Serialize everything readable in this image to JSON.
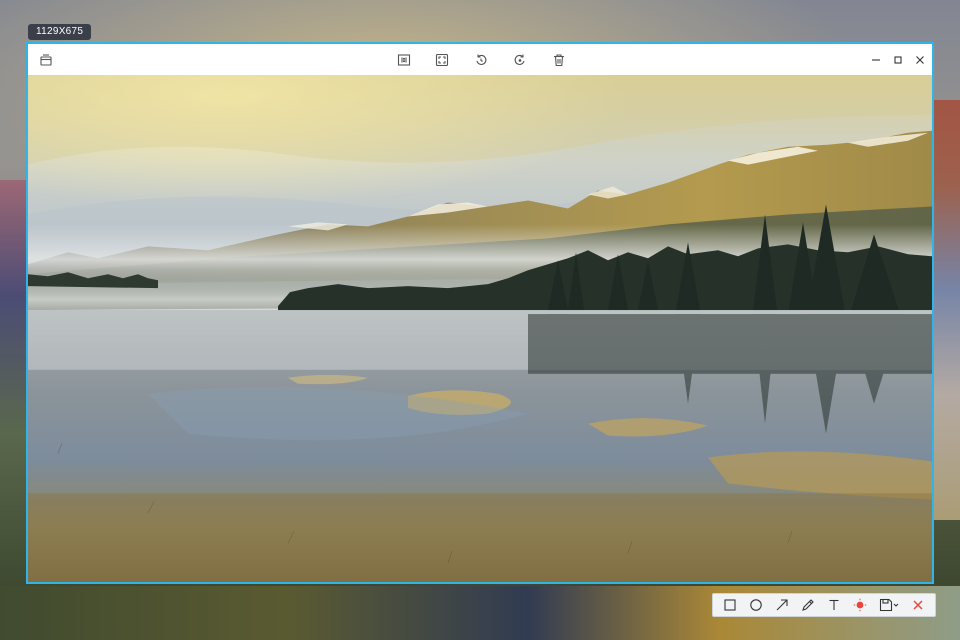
{
  "capture": {
    "size_label": "1129X675"
  },
  "window_toolbar": {
    "center_icons": [
      "actual-size-icon",
      "fit-screen-icon",
      "rotate-left-icon",
      "rotate-right-icon",
      "delete-icon"
    ],
    "right_icons": [
      "minimize-icon",
      "maximize-icon",
      "close-icon"
    ],
    "left_icon": "pin-window-icon"
  },
  "annotation_toolbar": {
    "tools": [
      "rectangle-icon",
      "ellipse-icon",
      "arrow-icon",
      "pen-icon",
      "text-icon",
      "color-picker-icon",
      "save-icon",
      "cancel-icon"
    ],
    "accent_color": "#e8453c"
  },
  "colors": {
    "selection_border": "#2fb5e8",
    "badge_bg": "#3a3f4a"
  }
}
